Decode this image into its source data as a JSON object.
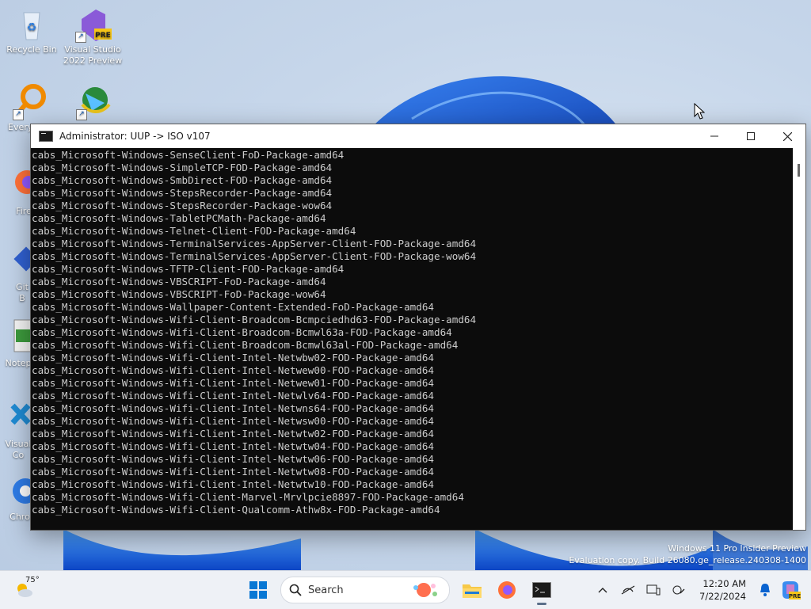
{
  "desktop": {
    "icons": [
      {
        "label": "Recycle Bin"
      },
      {
        "label": "Visual Studio 2022 Preview",
        "badge": "PRE"
      },
      {
        "label": "Every"
      },
      {
        "label": ""
      },
      {
        "label": "Fire"
      },
      {
        "label": "Git B"
      },
      {
        "label": "Notep"
      },
      {
        "label": "Visual Co"
      },
      {
        "label": "Chro"
      }
    ],
    "watermark": {
      "line1": "Windows 11 Pro Insider Preview",
      "line2": "Evaluation copy. Build 26080.ge_release.240308-1400"
    }
  },
  "window": {
    "title": "Administrator:  UUP -> ISO v107",
    "controls": {
      "minimize": "minimize-icon",
      "maximize": "maximize-icon",
      "close": "close-icon"
    },
    "lines": [
      "cabs_Microsoft-Windows-SenseClient-FoD-Package-amd64",
      "cabs_Microsoft-Windows-SimpleTCP-FOD-Package-amd64",
      "cabs_Microsoft-Windows-SmbDirect-FOD-Package-amd64",
      "cabs_Microsoft-Windows-StepsRecorder-Package-amd64",
      "cabs_Microsoft-Windows-StepsRecorder-Package-wow64",
      "cabs_Microsoft-Windows-TabletPCMath-Package-amd64",
      "cabs_Microsoft-Windows-Telnet-Client-FOD-Package-amd64",
      "cabs_Microsoft-Windows-TerminalServices-AppServer-Client-FOD-Package-amd64",
      "cabs_Microsoft-Windows-TerminalServices-AppServer-Client-FOD-Package-wow64",
      "cabs_Microsoft-Windows-TFTP-Client-FOD-Package-amd64",
      "cabs_Microsoft-Windows-VBSCRIPT-FoD-Package-amd64",
      "cabs_Microsoft-Windows-VBSCRIPT-FoD-Package-wow64",
      "cabs_Microsoft-Windows-Wallpaper-Content-Extended-FoD-Package-amd64",
      "cabs_Microsoft-Windows-Wifi-Client-Broadcom-Bcmpciedhd63-FOD-Package-amd64",
      "cabs_Microsoft-Windows-Wifi-Client-Broadcom-Bcmwl63a-FOD-Package-amd64",
      "cabs_Microsoft-Windows-Wifi-Client-Broadcom-Bcmwl63al-FOD-Package-amd64",
      "cabs_Microsoft-Windows-Wifi-Client-Intel-Netwbw02-FOD-Package-amd64",
      "cabs_Microsoft-Windows-Wifi-Client-Intel-Netwew00-FOD-Package-amd64",
      "cabs_Microsoft-Windows-Wifi-Client-Intel-Netwew01-FOD-Package-amd64",
      "cabs_Microsoft-Windows-Wifi-Client-Intel-Netwlv64-FOD-Package-amd64",
      "cabs_Microsoft-Windows-Wifi-Client-Intel-Netwns64-FOD-Package-amd64",
      "cabs_Microsoft-Windows-Wifi-Client-Intel-Netwsw00-FOD-Package-amd64",
      "cabs_Microsoft-Windows-Wifi-Client-Intel-Netwtw02-FOD-Package-amd64",
      "cabs_Microsoft-Windows-Wifi-Client-Intel-Netwtw04-FOD-Package-amd64",
      "cabs_Microsoft-Windows-Wifi-Client-Intel-Netwtw06-FOD-Package-amd64",
      "cabs_Microsoft-Windows-Wifi-Client-Intel-Netwtw08-FOD-Package-amd64",
      "cabs_Microsoft-Windows-Wifi-Client-Intel-Netwtw10-FOD-Package-amd64",
      "cabs_Microsoft-Windows-Wifi-Client-Marvel-Mrvlpcie8897-FOD-Package-amd64",
      "cabs_Microsoft-Windows-Wifi-Client-Qualcomm-Athw8x-FOD-Package-amd64"
    ]
  },
  "taskbar": {
    "weather": {
      "temp": "75°"
    },
    "search": {
      "placeholder": "Search"
    },
    "apps": [
      "start-icon",
      "file-explorer-icon",
      "firefox-icon",
      "terminal-icon"
    ],
    "tray": [
      "chevron-up-icon",
      "network-offline-icon",
      "display-icon",
      "accessibility-icon"
    ],
    "clock": {
      "time": "12:20 AM",
      "date": "7/22/2024"
    }
  },
  "colors": {
    "console_bg": "#0c0c0c",
    "console_fg": "#cccccc",
    "accent": "#0067c0"
  }
}
